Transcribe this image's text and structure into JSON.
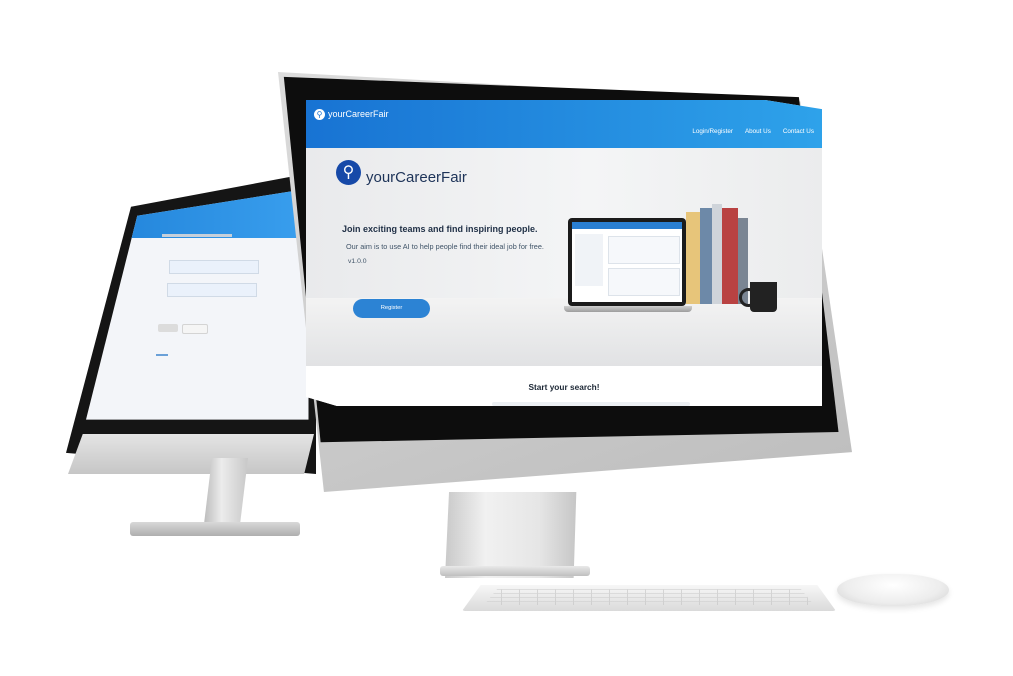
{
  "main_screen": {
    "nav": {
      "brand": "yourCareerFair",
      "links": [
        "Login/Register",
        "About Us",
        "Contact Us"
      ]
    },
    "hero": {
      "brand": "yourCareerFair",
      "title": "Join exciting teams and find inspiring people.",
      "subtitle": "Our aim is to use AI to help people find their ideal job for free.",
      "version": "v1.0.0",
      "register_label": "Register"
    },
    "search": {
      "heading": "Start your search!"
    }
  },
  "colors": {
    "nav_start": "#1873d3",
    "nav_end": "#2ea2ea",
    "brand_logo": "#1649a8",
    "register_button": "#2c83d4"
  },
  "icons": [
    "career-fair-logo-icon"
  ]
}
